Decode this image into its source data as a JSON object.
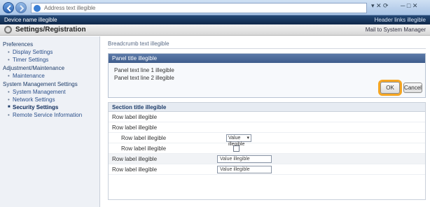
{
  "browser": {
    "address": "Address text illegible",
    "window_controls": "─ □ ✕",
    "address_tools": "▾ ✕ ⟳"
  },
  "device": {
    "name": "Device name illegible",
    "links": "Header links illegible"
  },
  "app": {
    "title": "Settings/Registration",
    "right_links": "Mail to System Manager"
  },
  "sidebar": {
    "groups": [
      {
        "label": "Preferences",
        "items": [
          "Display Settings",
          "Timer Settings"
        ]
      },
      {
        "label": "Adjustment/Maintenance",
        "items": [
          "Maintenance"
        ]
      },
      {
        "label": "System Management Settings",
        "items": [
          "System Management",
          "Network Settings",
          "Security Settings",
          "Remote Service Information"
        ]
      }
    ],
    "active_item": "Security Settings"
  },
  "breadcrumb": "Breadcrumb text illegible",
  "panel": {
    "title": "Panel title illegible",
    "line1": "Panel text line 1 illegible",
    "line2": "Panel text line 2 illegible",
    "ok_label": "OK",
    "cancel_label": "Cancel"
  },
  "network": {
    "title": "Section title illegible",
    "rows": [
      {
        "label": "Row label illegible",
        "type": "text",
        "value": ""
      },
      {
        "label": "Row label illegible",
        "type": "text",
        "value": ""
      },
      {
        "label": "Row label illegible",
        "type": "select",
        "value": "Value illegible"
      },
      {
        "label": "Row label illegible",
        "type": "checkbox",
        "value": ""
      },
      {
        "label": "Row label illegible",
        "type": "input",
        "value": "Value illegible"
      },
      {
        "label": "Row label illegible",
        "type": "input",
        "value": "Value illegible"
      }
    ]
  },
  "colors": {
    "accent": "#f5a623",
    "panel_header": "#3f5d8c",
    "header_bar": "#10284a"
  }
}
